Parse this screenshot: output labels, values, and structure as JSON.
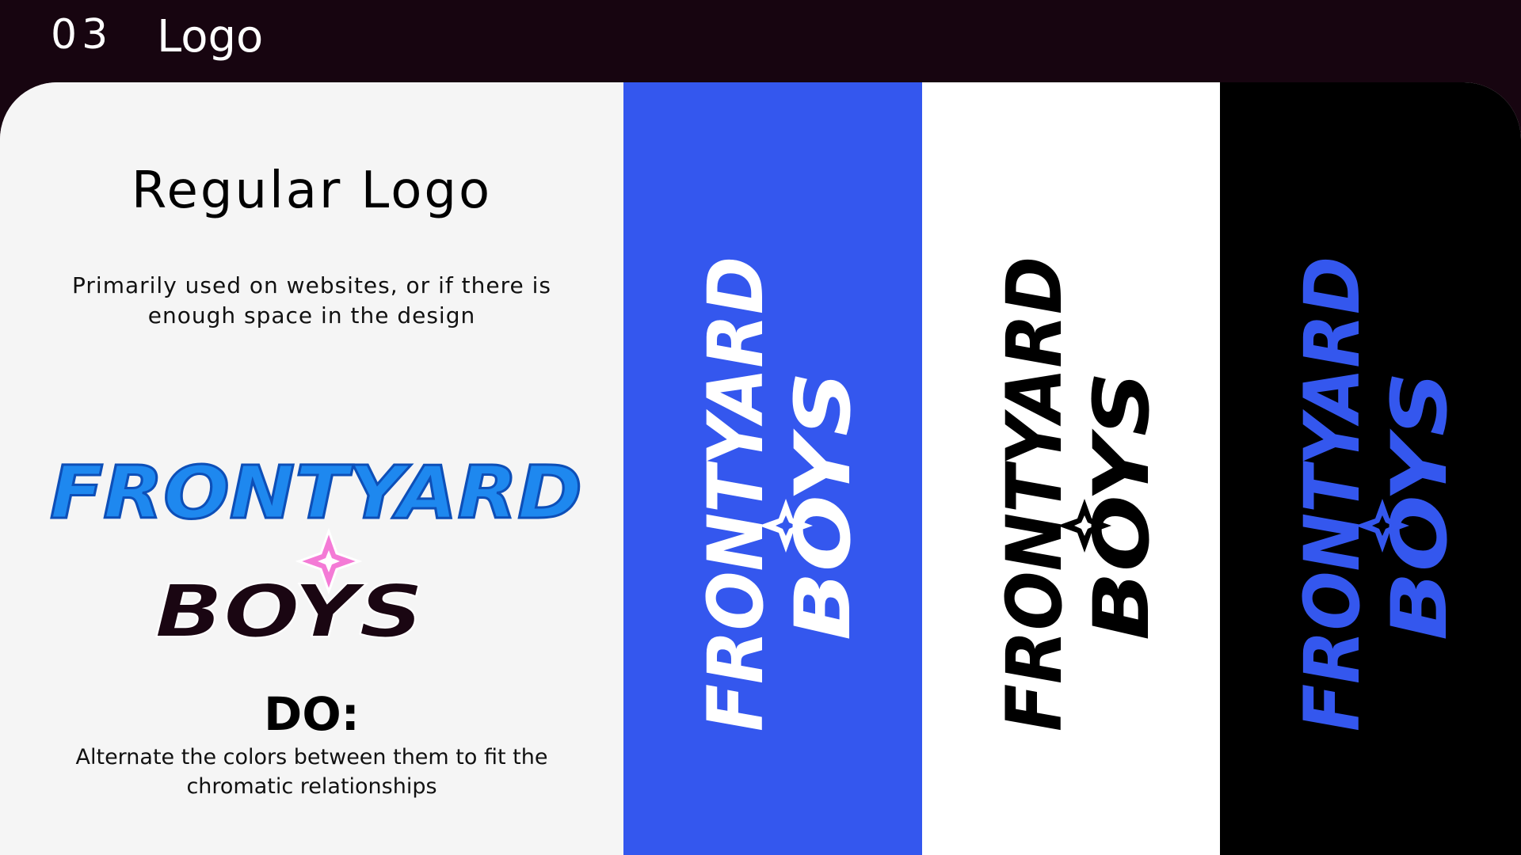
{
  "header": {
    "section_number": "03",
    "section_title": "Logo"
  },
  "regular": {
    "title": "Regular Logo",
    "description": "Primarily used on websites, or if there is enough space in the design"
  },
  "logo": {
    "line1": "FRONTYARD",
    "line2": "BOYS",
    "icon": "four-point-star-icon"
  },
  "do_section": {
    "title": "DO:",
    "description": "Alternate the colors between them to fit the chromatic relationships"
  },
  "colors": {
    "brand_blue": "#3457ee",
    "logo_light_blue": "#1e88ef",
    "star_pink": "#f47ad6",
    "logo_dark": "#1a0612",
    "header_bg": "#170510"
  },
  "variants": [
    {
      "background": "#3457ee",
      "logo_color": "#ffffff"
    },
    {
      "background": "#ffffff",
      "logo_color": "#000000"
    },
    {
      "background": "#000000",
      "logo_color": "#3457ee"
    }
  ]
}
